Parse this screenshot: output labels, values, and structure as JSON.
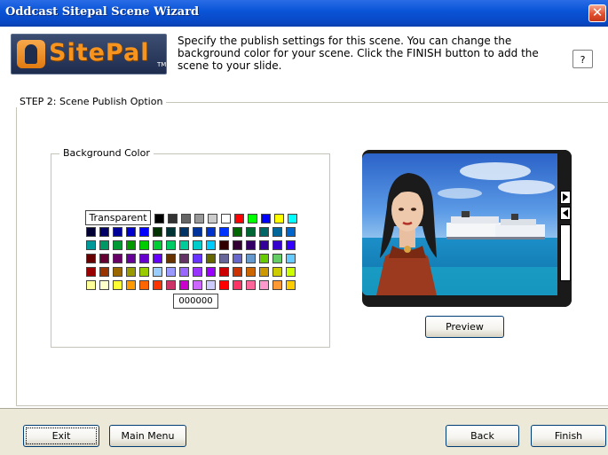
{
  "window": {
    "title": "Oddcast Sitepal Scene Wizard",
    "close_glyph": "✕"
  },
  "header": {
    "brand": "SitePal",
    "tm": "TM",
    "instruction": "Specify the publish settings for this scene. You can change the background color for your scene. Click the FINISH button to add the scene to your slide.",
    "help_label": "?"
  },
  "step": {
    "legend": "STEP 2: Scene Publish Option"
  },
  "background_color": {
    "legend": "Background Color",
    "transparent_label": "Transparent",
    "selected_hex": "000000",
    "top_row": [
      "#000000",
      "#333333",
      "#666666",
      "#999999",
      "#CCCCCC",
      "#FFFFFF",
      "#FF0000",
      "#00FF00",
      "#0000FF",
      "#FFFF00",
      "#00FFFF"
    ],
    "grid": [
      [
        "#000033",
        "#000066",
        "#000099",
        "#0000CC",
        "#0000FF",
        "#003300",
        "#003333",
        "#003366",
        "#003399",
        "#0033CC",
        "#0033FF",
        "#006600",
        "#006633",
        "#006666",
        "#006699",
        "#0066CC"
      ],
      [
        "#009999",
        "#009966",
        "#009933",
        "#009900",
        "#00CC00",
        "#00CC33",
        "#00CC66",
        "#00CC99",
        "#00CCCC",
        "#00CCFF",
        "#330000",
        "#330033",
        "#330066",
        "#330099",
        "#3300CC",
        "#3300FF"
      ],
      [
        "#660000",
        "#660033",
        "#660066",
        "#660099",
        "#6600CC",
        "#6600FF",
        "#663300",
        "#663366",
        "#6633FF",
        "#666600",
        "#666699",
        "#6666CC",
        "#6699CC",
        "#66CC00",
        "#66CC66",
        "#66CCFF"
      ],
      [
        "#990000",
        "#993300",
        "#996600",
        "#999900",
        "#99CC00",
        "#99CCFF",
        "#9999FF",
        "#9966FF",
        "#9933FF",
        "#9900FF",
        "#CC0000",
        "#CC3300",
        "#CC6600",
        "#CC9900",
        "#CCCC00",
        "#CCFF00"
      ],
      [
        "#FFFF99",
        "#FFFFCC",
        "#FFFF33",
        "#FF9900",
        "#FF6600",
        "#FF3300",
        "#CC3366",
        "#CC00CC",
        "#CC66FF",
        "#CCCCFF",
        "#FF0000",
        "#FF3366",
        "#FF6699",
        "#FF99CC",
        "#FF9933",
        "#FFCC00"
      ]
    ]
  },
  "preview": {
    "button_label": "Preview"
  },
  "footer": {
    "exit_label": "Exit",
    "main_menu_label": "Main Menu",
    "back_label": "Back",
    "finish_label": "Finish"
  }
}
